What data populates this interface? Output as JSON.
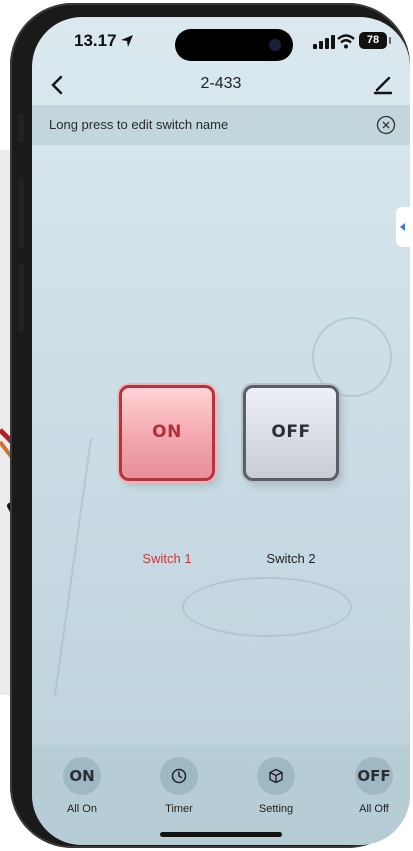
{
  "status_bar": {
    "time": "13.17",
    "battery": "78"
  },
  "nav": {
    "title": "2-433"
  },
  "hint": {
    "text": "Long press to edit switch name"
  },
  "switches": [
    {
      "state_label": "ON",
      "name": "Switch 1",
      "on": true,
      "accent": "#c7363f"
    },
    {
      "state_label": "OFF",
      "name": "Switch 2",
      "on": false,
      "accent": "#5a5f66"
    }
  ],
  "bottom_bar": [
    {
      "icon_text": "ON",
      "label": "All On"
    },
    {
      "icon": "clock-icon",
      "label": "Timer"
    },
    {
      "icon": "cube-icon",
      "label": "Setting"
    },
    {
      "icon_text": "OFF",
      "label": "All Off"
    }
  ],
  "colors": {
    "on_red": "#c7363f",
    "side_tab_blue": "#3a7bd5"
  }
}
